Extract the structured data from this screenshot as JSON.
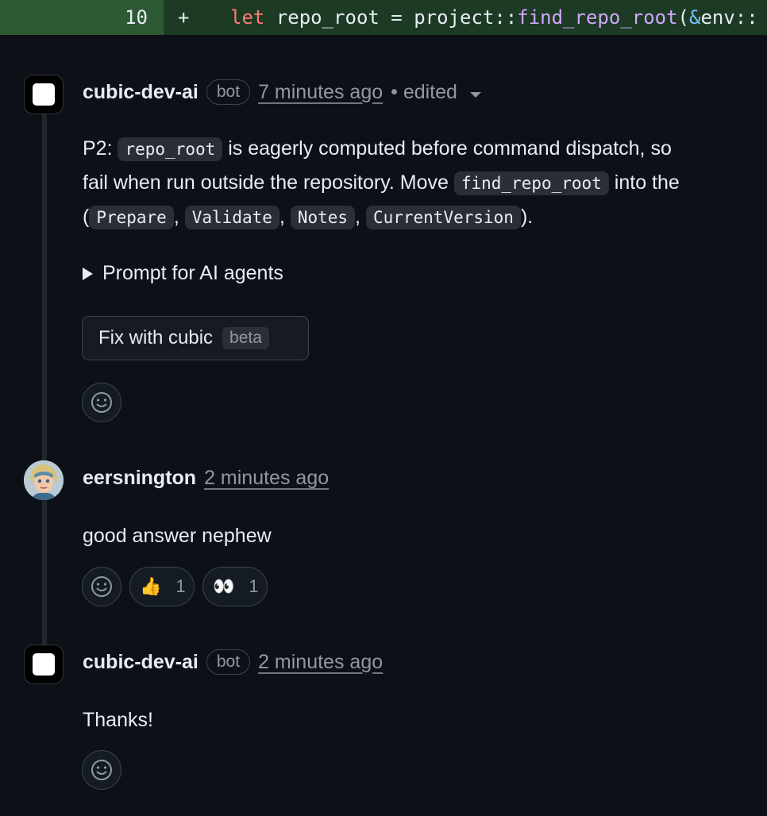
{
  "diff": {
    "line_number": "10",
    "marker": "+",
    "code": {
      "kw": "let",
      "text1": " repo_root = project::",
      "fn": "find_repo_root",
      "paren": "(",
      "amp": "&",
      "text2": "env::"
    }
  },
  "comments": [
    {
      "author": "cubic-dev-ai",
      "badge": "bot",
      "time": "7 minutes ago",
      "edited": "• edited",
      "body": {
        "p2_label": "P2:",
        "code_repo_root": "repo_root",
        "text_a": " is eagerly computed before command dispatch, so ",
        "text_b": "fail when run outside the repository. Move ",
        "code_find": "find_repo_root",
        "text_c": " into the",
        "paren_open": "(",
        "code_prepare": "Prepare",
        "code_validate": "Validate",
        "code_notes": "Notes",
        "code_current": "CurrentVersion",
        "sep": ",",
        "paren_close": ")."
      },
      "details_summary": "Prompt for AI agents",
      "fix_button": "Fix with cubic",
      "fix_badge": "beta"
    },
    {
      "author": "eersnington",
      "time": "2 minutes ago",
      "body": "good answer nephew",
      "reactions": [
        {
          "emoji": "👍",
          "count": "1"
        },
        {
          "emoji": "👀",
          "count": "1"
        }
      ]
    },
    {
      "author": "cubic-dev-ai",
      "badge": "bot",
      "time": "2 minutes ago",
      "body": "Thanks!"
    }
  ],
  "icons": {
    "bot_avatar": "cubic-logo-icon",
    "user_avatar": "avatar",
    "emoji_picker": "smiley-icon",
    "caret": "chevron-down-icon",
    "details": "triangle-right-icon"
  },
  "colors": {
    "background": "#0d1117",
    "diff_added_num": "#2d5a34",
    "diff_added_line": "#1c3a24",
    "muted": "#9198a1",
    "border": "#3d444d"
  }
}
